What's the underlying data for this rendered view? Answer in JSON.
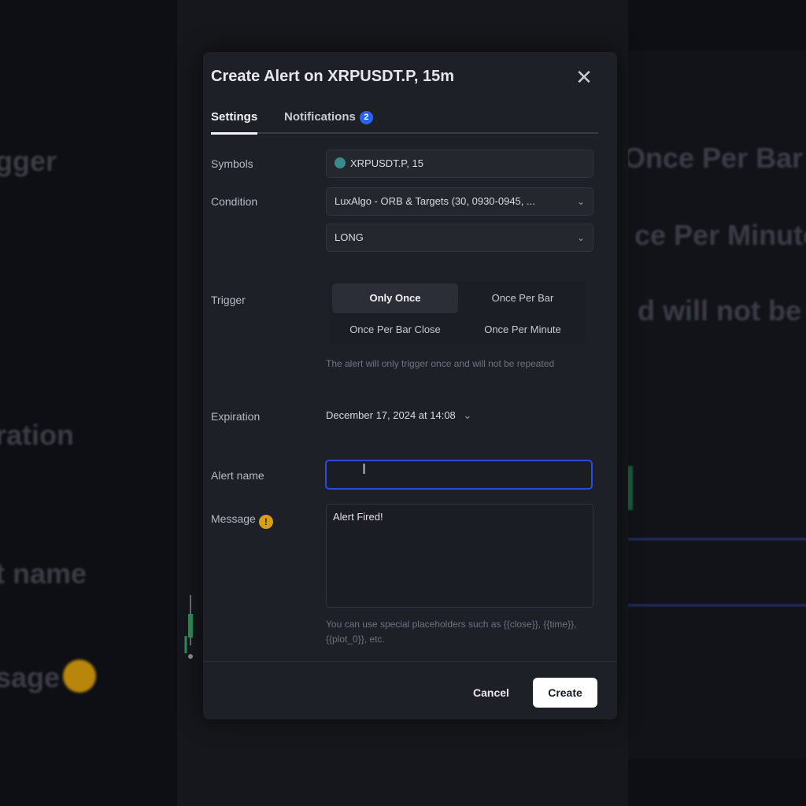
{
  "background": {
    "left_texts": [
      "gger",
      "ration",
      "t name",
      "sage"
    ],
    "right_texts": [
      "Once Per Bar",
      "ce Per Minute",
      "d will not be"
    ]
  },
  "dialog": {
    "title": "Create Alert on XRPUSDT.P, 15m",
    "close_icon": "close-icon",
    "tabs": [
      {
        "label": "Settings",
        "active": true
      },
      {
        "label": "Notifications",
        "badge": "2"
      }
    ]
  },
  "settings": {
    "symbol_label": "Symbols",
    "symbol_value": "XRPUSDT.P, 15",
    "condition_label": "Condition",
    "condition_value": "LuxAlgo - ORB & Targets (30, 0930-0945, ...",
    "condition_sub_value": "LONG",
    "trigger_label": "Trigger",
    "trigger_options": [
      "Only Once",
      "Once Per Bar",
      "Once Per Bar Close",
      "Once Per Minute"
    ],
    "trigger_selected": "Only Once",
    "trigger_hint": "The alert will only trigger once and will not be repeated",
    "expiration_label": "Expiration",
    "expiration_value": "December 17, 2024 at 14:08",
    "alert_name_label": "Alert name",
    "alert_name_value": "",
    "message_label": "Message",
    "message_warn": "!",
    "message_value": "Alert Fired!",
    "message_hint": "You can use special placeholders such as {{close}}, {{time}}, {{plot_0}}, etc."
  },
  "footer": {
    "cancel_label": "Cancel",
    "create_label": "Create"
  },
  "colors": {
    "accent": "#2962ff",
    "warn": "#d4a017",
    "dialog_bg": "#1e2027"
  }
}
